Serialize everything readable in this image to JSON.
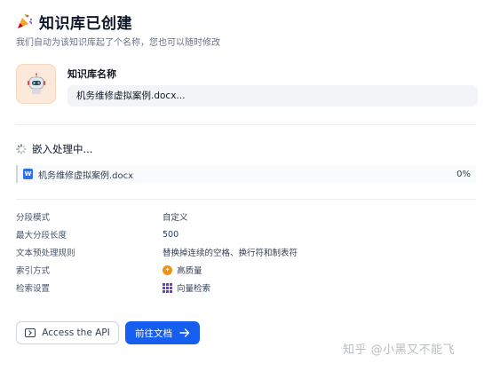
{
  "header": {
    "title": "知识库已创建",
    "subtitle": "我们自动为该知识库起了个名称，您也可以随时修改"
  },
  "knowledge_base": {
    "name_label": "知识库名称",
    "name_value": "机务维修虚拟案例.docx..."
  },
  "embedding": {
    "title": "嵌入处理中...",
    "files": [
      {
        "name": "机务维修虚拟案例.docx",
        "progress": "0%"
      }
    ]
  },
  "settings": [
    {
      "label": "分段模式",
      "value": "自定义",
      "icon": ""
    },
    {
      "label": "最大分段长度",
      "value": "500",
      "icon": ""
    },
    {
      "label": "文本预处理规则",
      "value": "替换掉连续的空格、换行符和制表符",
      "icon": ""
    },
    {
      "label": "索引方式",
      "value": "高质量",
      "icon": "quality-icon"
    },
    {
      "label": "检索设置",
      "value": "向量检索",
      "icon": "grid-icon"
    }
  ],
  "actions": {
    "api_label": "Access the API",
    "docs_label": "前往文档"
  },
  "watermark": "知乎 @小黑又不能飞",
  "colors": {
    "primary": "#155eef",
    "avatar_bg": "#fde9d9",
    "quality_orange": "#f79009",
    "vector_purple": "#6938ef"
  }
}
